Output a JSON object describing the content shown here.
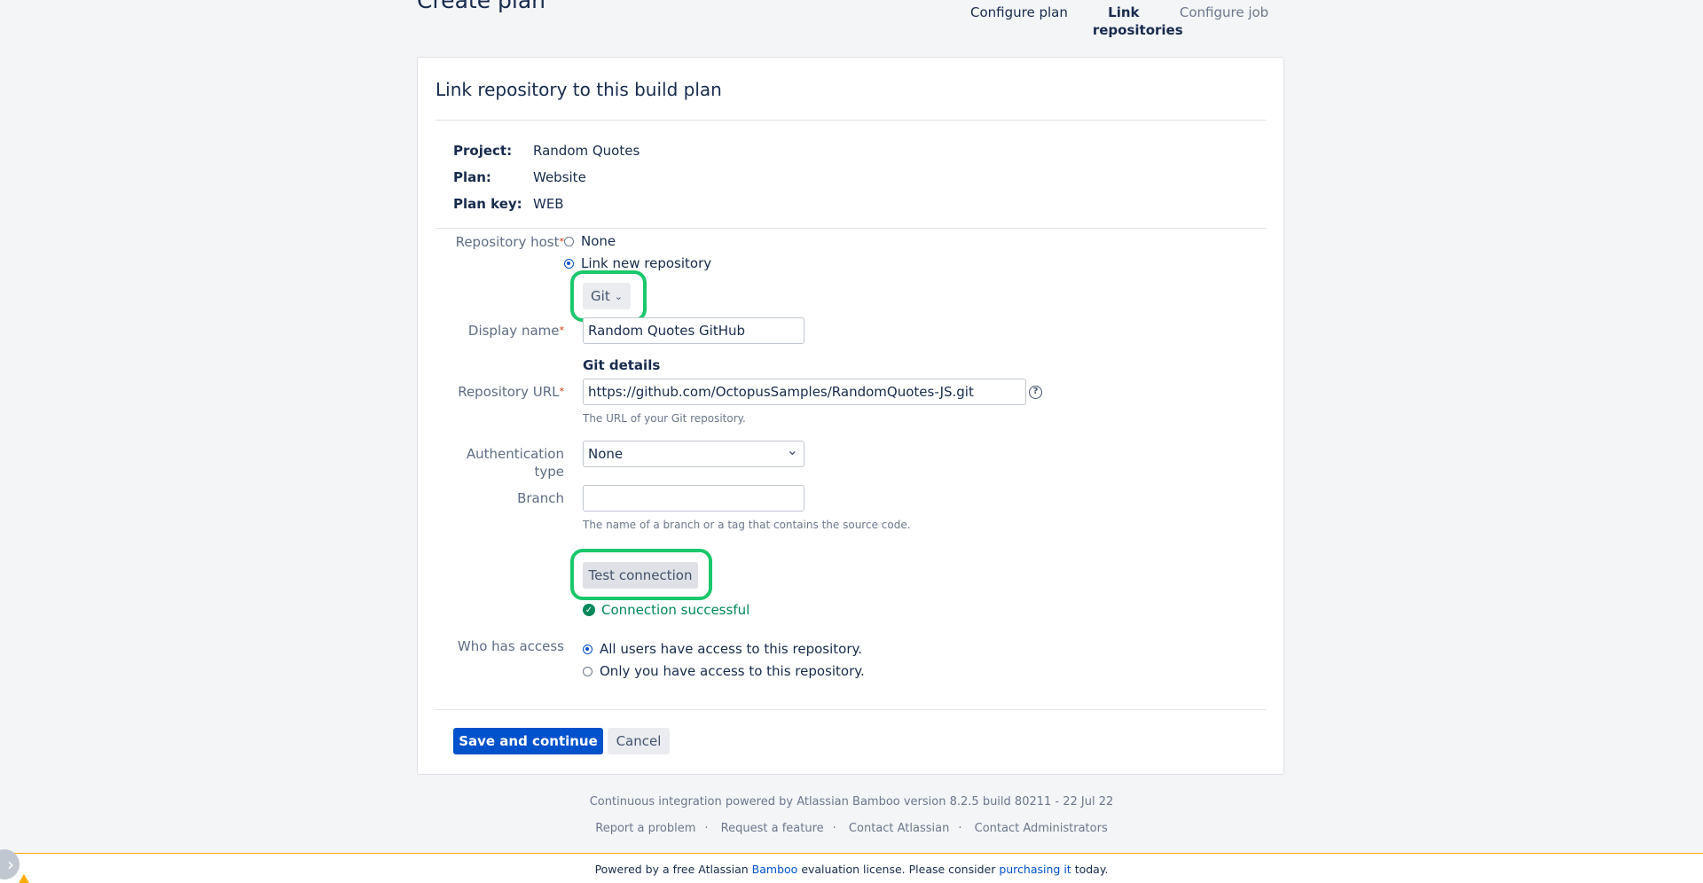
{
  "header": {
    "title": "Create plan",
    "steps": [
      "Configure plan",
      "Link repositories",
      "Configure job"
    ]
  },
  "panel": {
    "heading": "Link repository to this build plan",
    "meta": [
      {
        "label": "Project:",
        "value": "Random Quotes"
      },
      {
        "label": "Plan:",
        "value": "Website"
      },
      {
        "label": "Plan key:",
        "value": "WEB"
      }
    ]
  },
  "form": {
    "repo_host_label": "Repository host",
    "repo_host_options": [
      "None",
      "Link new repository"
    ],
    "repo_host_selected": "Link new repository",
    "repo_type": "Git",
    "display_name_label": "Display name",
    "display_name_value": "Random Quotes GitHub",
    "git_details_heading": "Git details",
    "repo_url_label": "Repository URL",
    "repo_url_value": "https://github.com/OctopusSamples/RandomQuotes-JS.git",
    "repo_url_help": "The URL of your Git repository.",
    "auth_label": "Authentication type",
    "auth_value": "None",
    "branch_label": "Branch",
    "branch_value": "",
    "branch_help": "The name of a branch or a tag that contains the source code.",
    "test_button": "Test connection",
    "connection_status": "Connection successful",
    "access_label": "Who has access",
    "access_options": [
      "All users have access to this repository.",
      "Only you have access to this repository."
    ],
    "access_selected": "All users have access to this repository.",
    "save_button": "Save and continue",
    "cancel_button": "Cancel"
  },
  "footer": {
    "powered": "Continuous integration powered by Atlassian Bamboo version 8.2.5 build 80211 - 22 Jul 22",
    "links": [
      "Report a problem",
      "Request a feature",
      "Contact Atlassian",
      "Contact Administrators"
    ],
    "license_prefix": "Powered by a free Atlassian",
    "license_link1": "Bamboo",
    "license_middle": "evaluation license. Please consider",
    "license_link2": "purchasing it",
    "license_suffix": "today."
  },
  "colors": {
    "primary": "#0052cc",
    "success": "#00875a",
    "highlight": "#19c86b",
    "required": "#de350b"
  }
}
